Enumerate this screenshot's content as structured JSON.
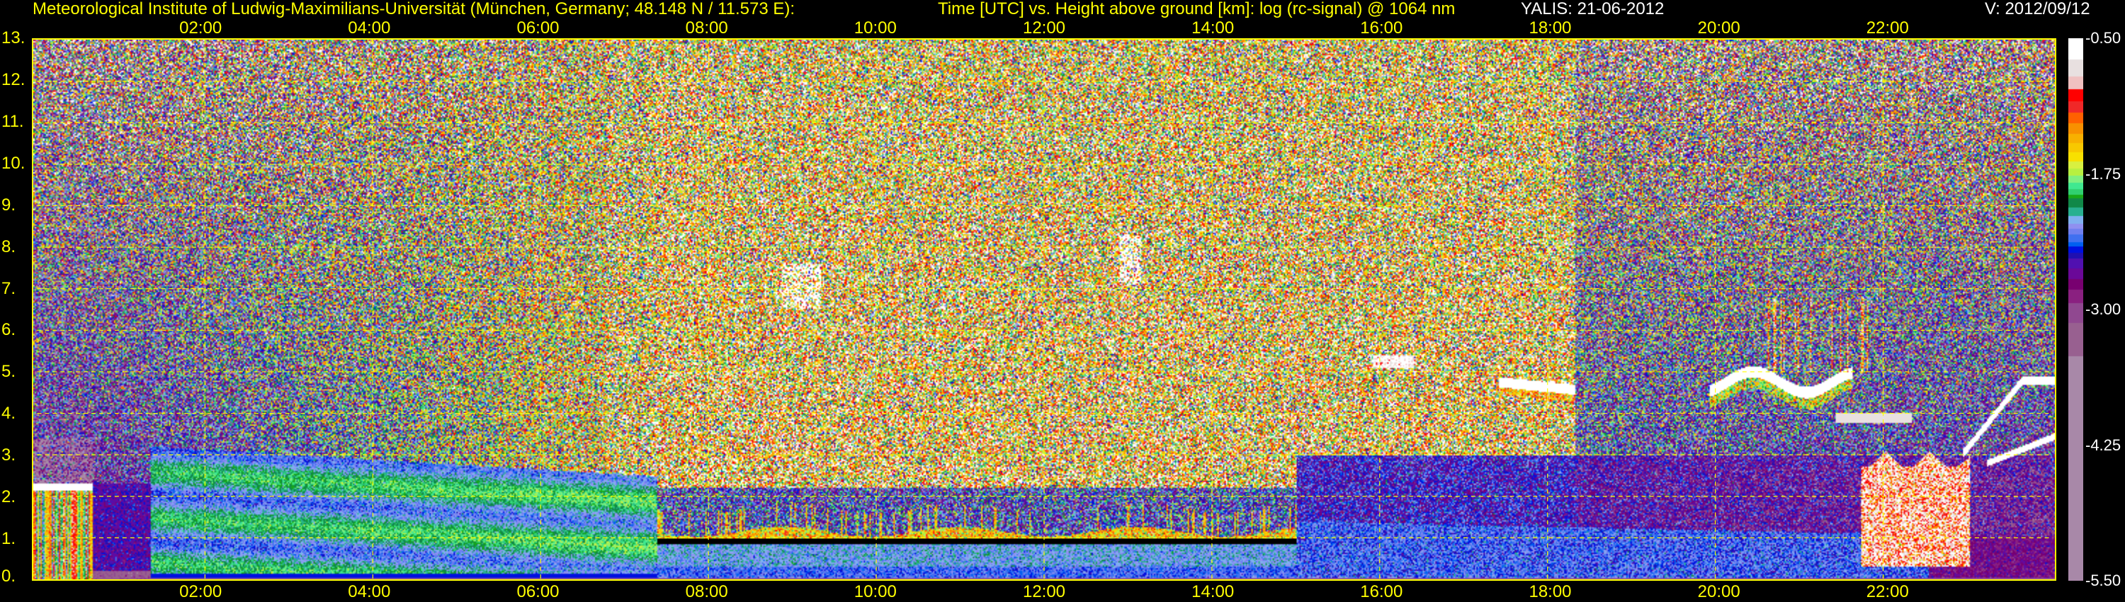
{
  "header": {
    "institute": "Meteorological Institute of Ludwig-Maximilians-Universität (München, Germany; 48.148 N / 11.573 E):",
    "plot_description": "Time [UTC] vs. Height above ground [km]: log (rc-signal) @ 1064 nm",
    "instrument_date": "YALIS: 21-06-2012",
    "version": "V: 2012/09/12"
  },
  "chart_data": {
    "type": "heatmap",
    "title": "Time [UTC] vs. Height above ground [km]: log (rc-signal) @ 1064 nm",
    "xlabel": "Time [UTC]",
    "ylabel": "Height above ground [km]",
    "xlim": [
      0,
      24
    ],
    "ylim": [
      0,
      13
    ],
    "grid": true,
    "x_ticks": [
      {
        "value": 2,
        "label": "02:00"
      },
      {
        "value": 4,
        "label": "04:00"
      },
      {
        "value": 6,
        "label": "06:00"
      },
      {
        "value": 8,
        "label": "08:00"
      },
      {
        "value": 10,
        "label": "10:00"
      },
      {
        "value": 12,
        "label": "12:00"
      },
      {
        "value": 14,
        "label": "14:00"
      },
      {
        "value": 16,
        "label": "16:00"
      },
      {
        "value": 18,
        "label": "18:00"
      },
      {
        "value": 20,
        "label": "20:00"
      },
      {
        "value": 22,
        "label": "22:00"
      }
    ],
    "y_ticks": [
      {
        "value": 0,
        "label": "0."
      },
      {
        "value": 1,
        "label": "1."
      },
      {
        "value": 2,
        "label": "2."
      },
      {
        "value": 3,
        "label": "3."
      },
      {
        "value": 4,
        "label": "4."
      },
      {
        "value": 5,
        "label": "5."
      },
      {
        "value": 6,
        "label": "6."
      },
      {
        "value": 7,
        "label": "7."
      },
      {
        "value": 8,
        "label": "8."
      },
      {
        "value": 9,
        "label": "9."
      },
      {
        "value": 10,
        "label": "10."
      },
      {
        "value": 11,
        "label": "11."
      },
      {
        "value": 12,
        "label": "12."
      },
      {
        "value": 13,
        "label": "13."
      }
    ],
    "colorbar": {
      "range": [
        -5.5,
        -0.5
      ],
      "ticks": [
        {
          "value": -0.5,
          "label": "-0.50"
        },
        {
          "value": -1.75,
          "label": "-1.75"
        },
        {
          "value": -3.0,
          "label": "-3.00"
        },
        {
          "value": -4.25,
          "label": "-4.25"
        },
        {
          "value": -5.5,
          "label": "-5.50"
        }
      ],
      "bands": [
        {
          "upper": -0.5,
          "color": "#ffffff"
        },
        {
          "upper": -0.695,
          "color": "#e8e0e0"
        },
        {
          "upper": -0.85,
          "color": "#f0c0c0"
        },
        {
          "upper": -0.965,
          "color": "#ff0000"
        },
        {
          "upper": -1.075,
          "color": "#f02828"
        },
        {
          "upper": -1.185,
          "color": "#ff6000"
        },
        {
          "upper": -1.28,
          "color": "#f89000"
        },
        {
          "upper": -1.375,
          "color": "#f8b000"
        },
        {
          "upper": -1.46,
          "color": "#f8c800"
        },
        {
          "upper": -1.545,
          "color": "#f8e000"
        },
        {
          "upper": -1.63,
          "color": "#d8f040"
        },
        {
          "upper": -1.7,
          "color": "#b8f040"
        },
        {
          "upper": -1.765,
          "color": "#80f080"
        },
        {
          "upper": -1.83,
          "color": "#40e890"
        },
        {
          "upper": -1.89,
          "color": "#30d070"
        },
        {
          "upper": -1.94,
          "color": "#18a818"
        },
        {
          "upper": -1.975,
          "color": "#108848"
        },
        {
          "upper": -2.06,
          "color": "#28b090"
        },
        {
          "upper": -2.135,
          "color": "#80b0f0"
        },
        {
          "upper": -2.205,
          "color": "#9090f0"
        },
        {
          "upper": -2.255,
          "color": "#7080f0"
        },
        {
          "upper": -2.305,
          "color": "#4070f0"
        },
        {
          "upper": -2.375,
          "color": "#0060f0"
        },
        {
          "upper": -2.415,
          "color": "#0010e0"
        },
        {
          "upper": -2.475,
          "color": "#2010b0"
        },
        {
          "upper": -2.53,
          "color": "#5010b0"
        },
        {
          "upper": -2.615,
          "color": "#6a0898"
        },
        {
          "upper": -2.715,
          "color": "#780070"
        },
        {
          "upper": -2.815,
          "color": "#8a2080"
        },
        {
          "upper": -2.94,
          "color": "#904890"
        },
        {
          "upper": -3.12,
          "color": "#986090"
        },
        {
          "upper": -3.43,
          "color": "#a888a8"
        }
      ]
    },
    "features": {
      "boundary_layer_night_top_km": [
        3.2,
        2.5
      ],
      "daytime_cloud_layer_km": 1.0,
      "clouds": [
        {
          "t": [
            0.0,
            0.7
          ],
          "h": [
            2.15,
            2.3
          ],
          "note": "precipitating cloud"
        },
        {
          "t": [
            15.9,
            16.4
          ],
          "h": [
            5.1,
            5.4
          ]
        },
        {
          "t": [
            17.4,
            18.3
          ],
          "h": [
            4.5,
            4.9
          ]
        },
        {
          "t": [
            19.9,
            21.6
          ],
          "h": [
            4.4,
            5.1
          ]
        },
        {
          "t": [
            21.7,
            23.0
          ],
          "h": [
            0.3,
            3.1
          ]
        },
        {
          "t": [
            22.9,
            24.0
          ],
          "h": [
            2.6,
            4.8
          ]
        }
      ]
    }
  }
}
